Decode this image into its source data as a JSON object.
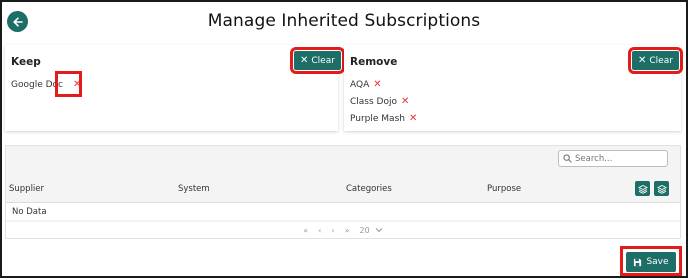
{
  "page": {
    "title": "Manage Inherited Subscriptions"
  },
  "keep": {
    "title": "Keep",
    "clear_label": "Clear",
    "items": [
      {
        "label": "Google Doc"
      }
    ]
  },
  "remove": {
    "title": "Remove",
    "clear_label": "Clear",
    "items": [
      {
        "label": "AQA"
      },
      {
        "label": "Class Dojo"
      },
      {
        "label": "Purple Mash"
      }
    ]
  },
  "grid": {
    "search_placeholder": "Search...",
    "columns": [
      "Supplier",
      "System",
      "Categories",
      "Purpose"
    ],
    "empty_text": "No Data",
    "pager": {
      "first": "«",
      "prev": "‹",
      "next": "›",
      "last": "»",
      "page_size": "20"
    }
  },
  "footer": {
    "save_label": "Save"
  },
  "colors": {
    "accent": "#1d6e66",
    "highlight": "#e41b1b",
    "remove_x": "#e33333"
  }
}
